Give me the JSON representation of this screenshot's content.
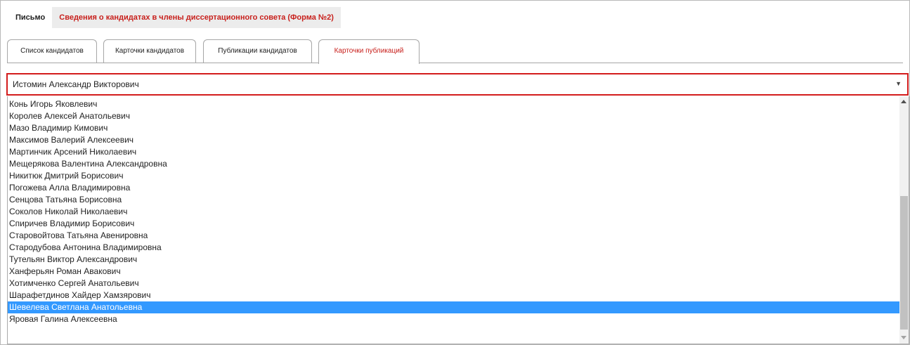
{
  "top_tabs": [
    {
      "label": "Письмо",
      "active": false
    },
    {
      "label": "Сведения о кандидатах в члены диссертационного совета (Форма №2)",
      "active": true
    }
  ],
  "sub_tabs": [
    {
      "label": "Список кандидатов",
      "active": false
    },
    {
      "label": "Карточки кандидатов",
      "active": false
    },
    {
      "label": "Публикации кандидатов",
      "active": false
    },
    {
      "label": "Карточки публикаций",
      "active": true
    }
  ],
  "select": {
    "value": "Истомин Александр Викторович",
    "arrow_icon": "triangle-down-icon"
  },
  "options": [
    "Конь Игорь Яковлевич",
    "Королев Алексей Анатольевич",
    "Мазо Владимир Кимович",
    "Максимов Валерий Алексеевич",
    "Мартинчик Арсений Николаевич",
    "Мещерякова Валентина Александровна",
    "Никитюк Дмитрий Борисович",
    "Погожева Алла Владимировна",
    "Сенцова Татьяна Борисовна",
    "Соколов Николай Николаевич",
    "Спиричев Владимир Борисович",
    "Старовойтова Татьяна Авенировна",
    "Стародубова Антонина Владимировна",
    "Тутельян Виктор Александрович",
    "Ханферьян Роман Авакович",
    "Хотимченко Сергей Анатольевич",
    "Шарафетдинов Хайдер Хамзярович",
    "Шевелева Светлана Анатольевна",
    "Яровая Галина Алексеевна"
  ],
  "selected_option": "Шевелева Светлана Анатольевна",
  "colors": {
    "accent_red": "#c8201c",
    "select_border": "#d31c1c",
    "highlight": "#3399ff"
  }
}
